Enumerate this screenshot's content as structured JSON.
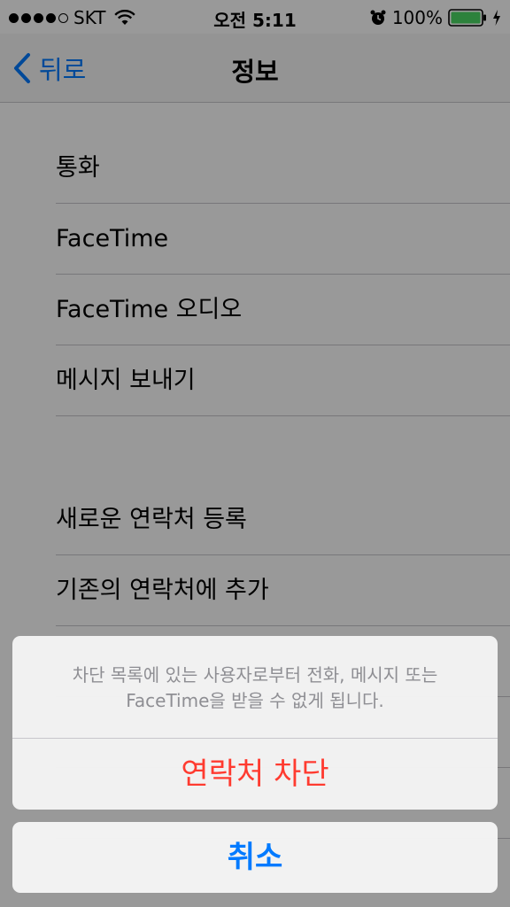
{
  "status_bar": {
    "carrier": "SKT",
    "time": "오전 5:11",
    "battery_percent": "100%",
    "signal_bars": 4,
    "signal_total": 5
  },
  "nav": {
    "back_label": "뒤로",
    "title": "정보"
  },
  "section_one": {
    "items": [
      "통화",
      "FaceTime",
      "FaceTime 오디오",
      "메시지 보내기"
    ]
  },
  "section_two": {
    "items": [
      "새로운 연락처 등록",
      "기존의 연락처에 추가",
      "",
      "",
      ""
    ]
  },
  "action_sheet": {
    "message": "차단 목록에 있는 사용자로부터 전화, 메시지 또는 FaceTime을 받을 수 없게 됩니다.",
    "destructive_label": "연락처 차단",
    "cancel_label": "취소"
  },
  "colors": {
    "accent": "#007aff",
    "destructive": "#ff3b30",
    "battery_green": "#4cd964"
  }
}
